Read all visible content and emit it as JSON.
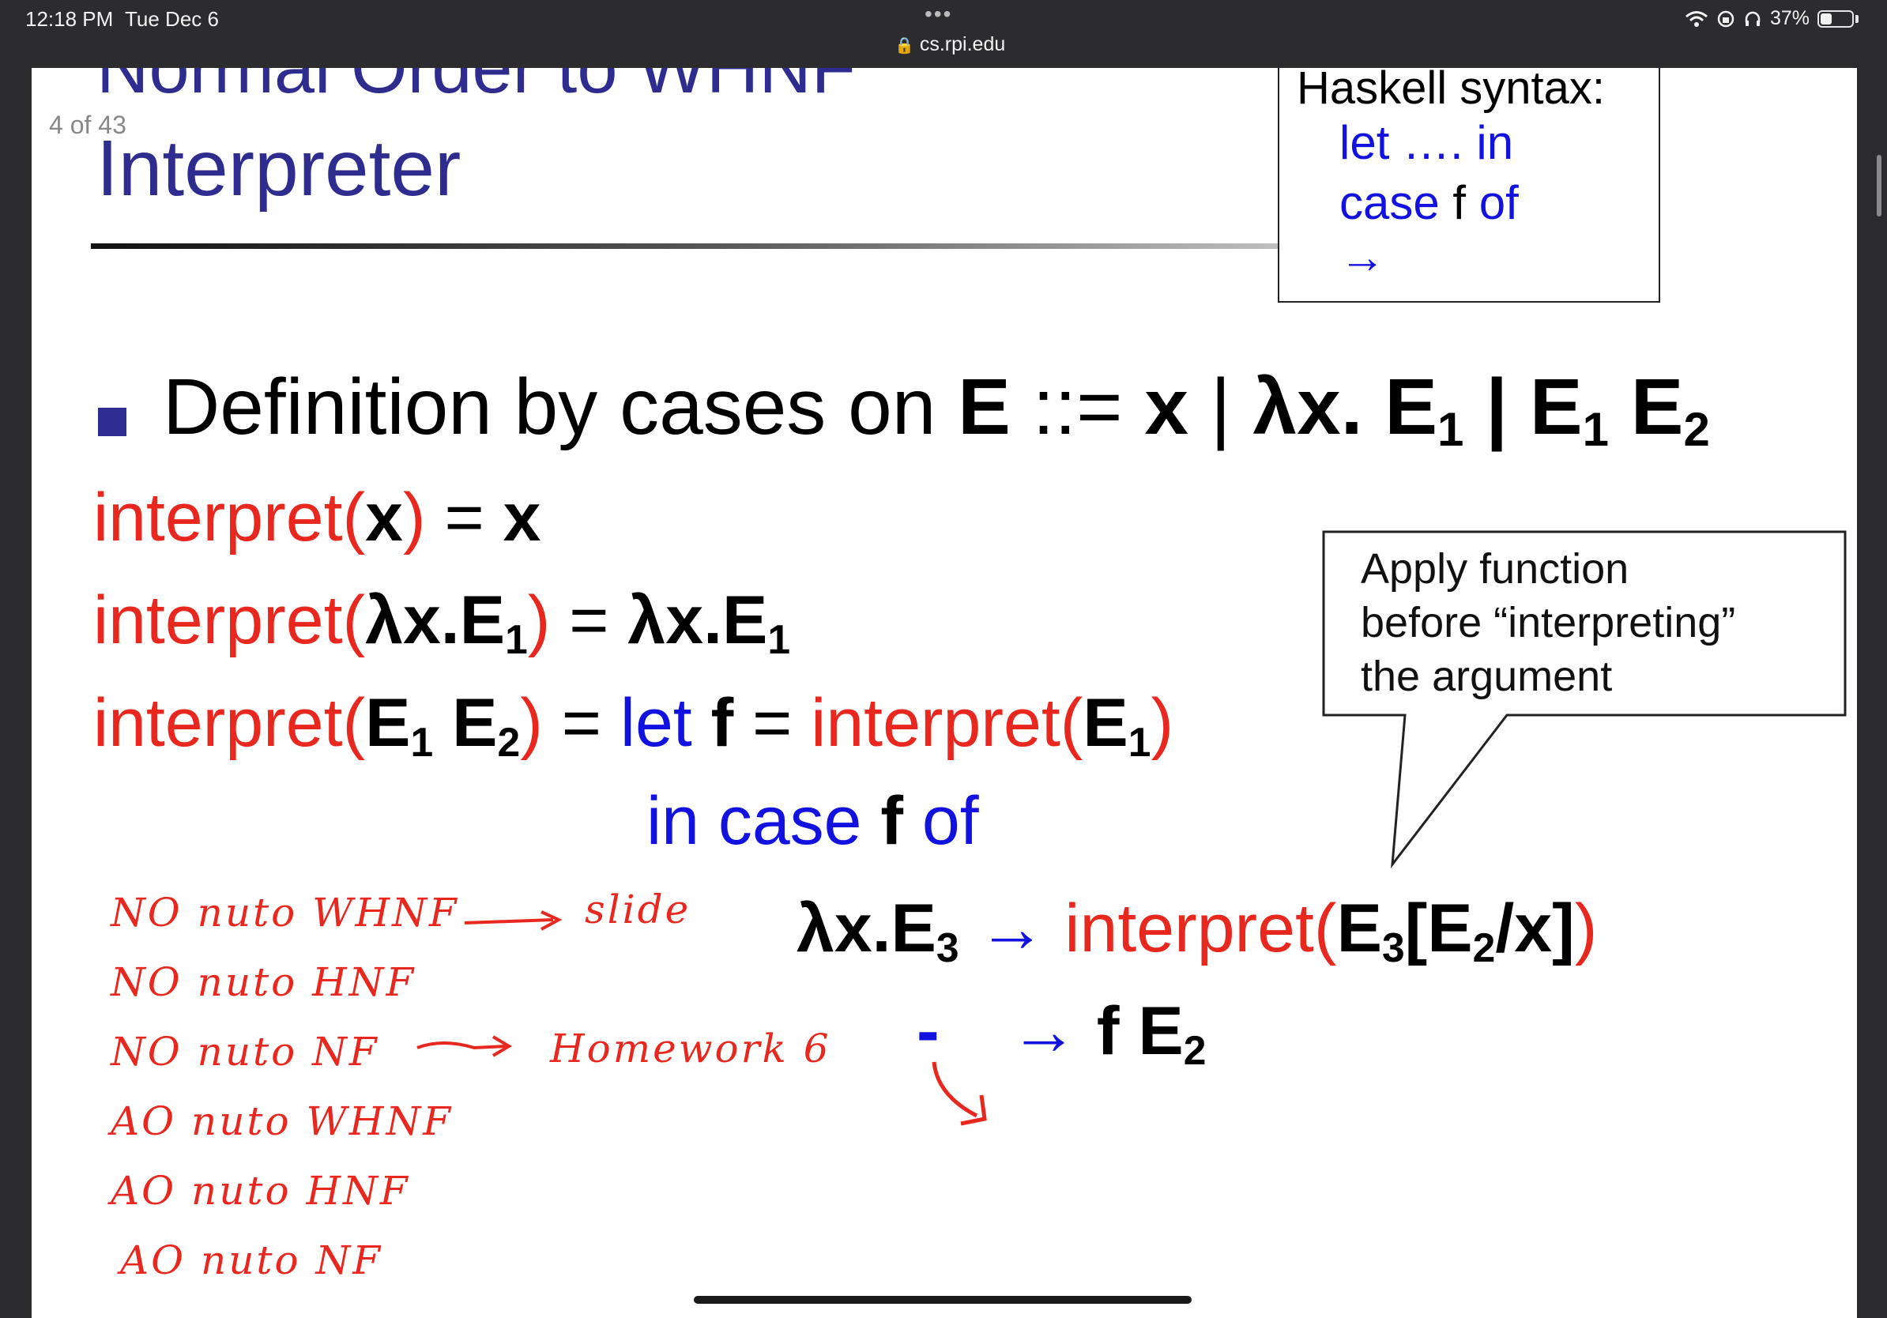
{
  "status_bar": {
    "time": "12:18 PM",
    "date": "Tue Dec 6",
    "url": "cs.rpi.edu",
    "battery": "37%",
    "battery_level": 0.37
  },
  "slide": {
    "page_indicator": "4 of 43",
    "title_line1": "Normal Order to WHNF",
    "title_line2": "Interpreter",
    "haskell_box": {
      "title": "Haskell syntax:",
      "line1": "let …. in",
      "line2_a": "case",
      "line2_b": " f ",
      "line2_c": "of",
      "line3": "→"
    },
    "bullet": {
      "prefix": "Definition by cases on ",
      "E": "E",
      "op": " ::= ",
      "x": "x",
      "bar1": " |  ",
      "lam": "λx. E",
      "sub1": "1",
      "bar2": "  | E",
      "sub2": "1",
      "e2": " E",
      "sub3": "2"
    },
    "rule1": {
      "fn": "interpret",
      "lp": "(",
      "arg": "x",
      "rp": ")",
      "eq": " = ",
      "res": "x"
    },
    "rule2": {
      "fn": "interpret",
      "lp": "(",
      "arg": "λx.E",
      "argsub": "1",
      "rp": ")",
      "eq": " = ",
      "res": "λx.E",
      "ressub": "1"
    },
    "rule3": {
      "fn": "interpret",
      "lp": "(",
      "a1": "E",
      "s1": "1",
      "a2": " E",
      "s2": "2",
      "rp": ")",
      "eq": " = ",
      "let": "let",
      "f": " f ",
      "eq2": "= ",
      "fn2": "interpret",
      "lp2": "(",
      "a3": "E",
      "s3": "1",
      "rp2": ")"
    },
    "rule3_cont": {
      "in_case": "in case ",
      "f": "f",
      "of": " of"
    },
    "case1": {
      "lhs": "λx.E",
      "lhssub": "3",
      "arrow": " → ",
      "fn": "interpret",
      "lp": "(",
      "a": "E",
      "s": "3",
      "b": "[E",
      "s2": "2",
      "c": "/x]",
      "rp": ")"
    },
    "case2": {
      "dash": "-",
      "arrow": "→",
      "rhs": " f E",
      "sub": "2"
    },
    "callout": {
      "line1": "Apply function",
      "line2": "before “interpreting”",
      "line3": "the argument"
    },
    "handwriting": {
      "l1": "NO  nuto  WHNF",
      "l1_note": "slide",
      "l2": "NO  nuto  HNF",
      "l3": "NO  nuto  NF",
      "l3_note": "Homework 6",
      "l4": "AO  nuto  WHNF",
      "l5": "AO  nuto  HNF",
      "l6": "AO  nuto  NF"
    }
  }
}
